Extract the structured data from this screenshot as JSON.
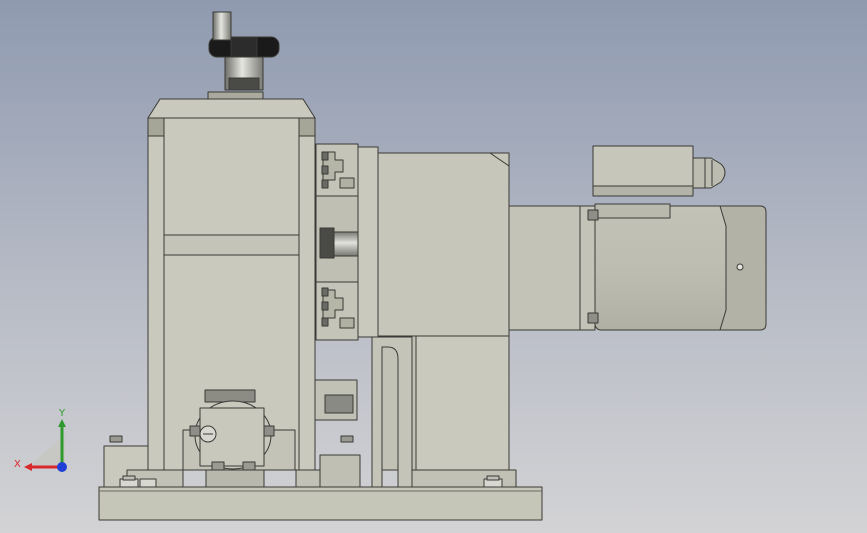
{
  "triad": {
    "x_label": "X",
    "y_label": "Y",
    "x_color": "#d8282a",
    "y_color": "#2e9a2e",
    "z_color": "#1f3fd8"
  },
  "colors": {
    "part_fill": "#c9c9bd",
    "part_dark": "#a9aa9d",
    "edge": "#3a3a36",
    "metal": "#9a9a94",
    "knob": "#1a1a1a"
  }
}
